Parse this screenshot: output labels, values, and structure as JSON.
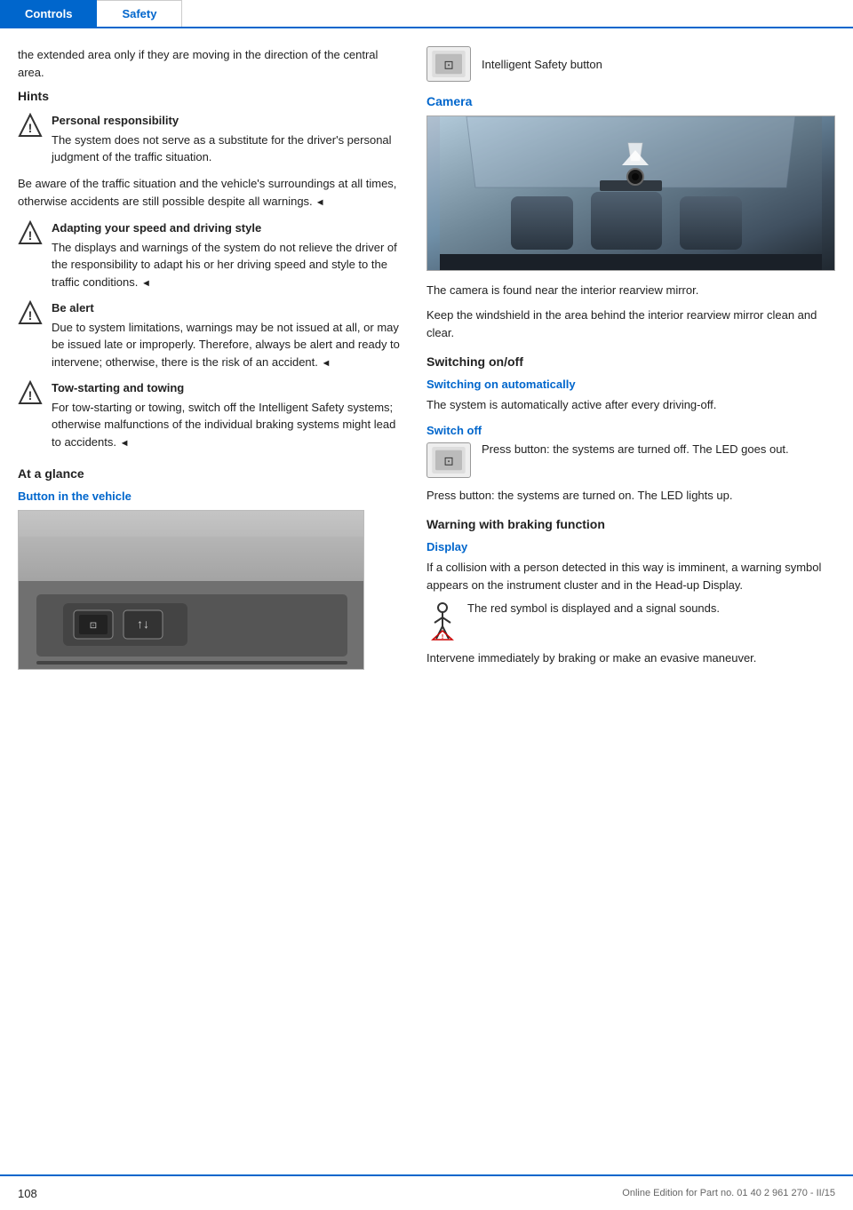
{
  "header": {
    "tab_controls": "Controls",
    "tab_safety": "Safety"
  },
  "left_col": {
    "intro_text": "the extended area only if they are moving in the direction of the central area.",
    "hints_heading": "Hints",
    "hint1_title": "Personal responsibility",
    "hint1_body": "The system does not serve as a substitute for the driver's personal judgment of the traffic situation.",
    "hint1_extra": "Be aware of the traffic situation and the vehicle's surroundings at all times, otherwise accidents are still possible despite all warnings.",
    "hint2_title": "Adapting your speed and driving style",
    "hint2_body": "The displays and warnings of the system do not relieve the driver of the responsibility to adapt his or her driving speed and style to the traffic conditions.",
    "hint3_title": "Be alert",
    "hint3_body": "Due to system limitations, warnings may be not issued at all, or may be issued late or improperly. Therefore, always be alert and ready to intervene; otherwise, there is the risk of an accident.",
    "hint4_title": "Tow-starting and towing",
    "hint4_body": "For tow-starting or towing, switch off the Intelligent Safety systems; otherwise malfunctions of the individual braking systems might lead to accidents.",
    "at_a_glance_heading": "At a glance",
    "button_in_vehicle_label": "Button in the vehicle"
  },
  "right_col": {
    "intelligent_safety_label": "Intelligent Safety button",
    "camera_heading": "Camera",
    "camera_text1": "The camera is found near the interior rearview mirror.",
    "camera_text2": "Keep the windshield in the area behind the interior rearview mirror clean and clear.",
    "switching_heading": "Switching on/off",
    "switching_auto_sub": "Switching on automatically",
    "switching_auto_text": "The system is automatically active after every driving-off.",
    "switch_off_sub": "Switch off",
    "switch_off_text1": "Press button: the systems are turned off. The LED goes out.",
    "switch_off_text2": "Press button: the systems are turned on. The LED lights up.",
    "warning_heading": "Warning with braking function",
    "display_sub": "Display",
    "display_text1": "If a collision with a person detected in this way is imminent, a warning symbol appears on the instrument cluster and in the Head-up Display.",
    "red_symbol_text": "The red symbol is displayed and a signal sounds.",
    "intervene_text": "Intervene immediately by braking or make an evasive maneuver."
  },
  "footer": {
    "page_number": "108",
    "footer_text": "Online Edition for Part no. 01 40 2 961 270 - II/15"
  }
}
